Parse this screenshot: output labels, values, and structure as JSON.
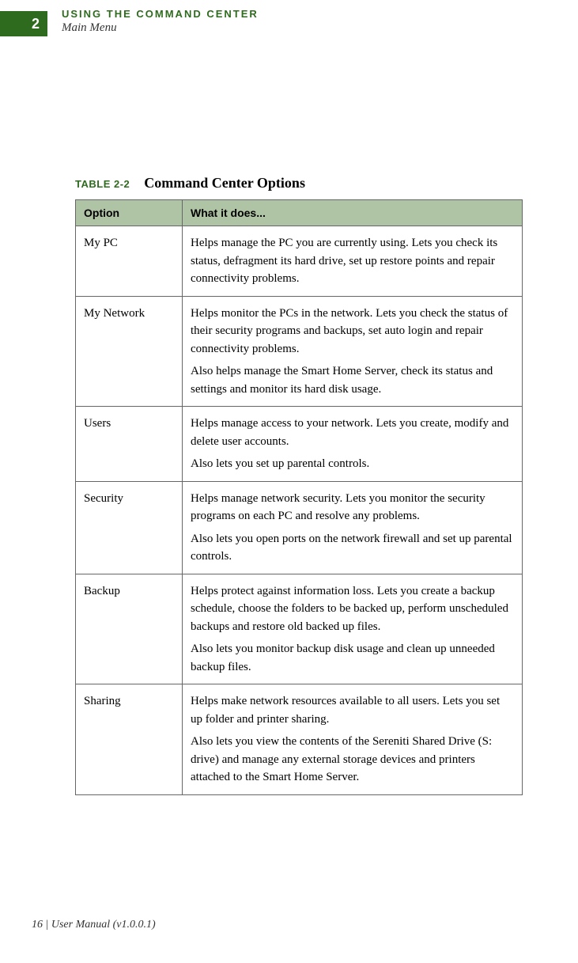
{
  "header": {
    "chapter_number": "2",
    "title": "USING THE COMMAND CENTER",
    "subtitle": "Main Menu"
  },
  "table": {
    "label": "TABLE 2-2",
    "title": "Command Center Options",
    "columns": {
      "option": "Option",
      "desc": "What it does..."
    },
    "rows": [
      {
        "option": "My PC",
        "p1": "Helps manage the PC you are currently using. Lets you check its status, defragment its hard drive, set up restore points and repair connectivity problems.",
        "p2": ""
      },
      {
        "option": "My Network",
        "p1": "Helps monitor the PCs in the network. Lets you check the status of their security programs and backups, set auto login and repair connectivity problems.",
        "p2": "Also helps manage the Smart Home Server, check its status and settings and monitor its hard disk usage."
      },
      {
        "option": "Users",
        "p1": "Helps manage access to your network. Lets you create, modify and delete user accounts.",
        "p2": "Also lets you set up parental controls."
      },
      {
        "option": "Security",
        "p1": "Helps manage network security. Lets you monitor the security programs on each PC and resolve any problems.",
        "p2": "Also lets you open ports on the network firewall and set up parental controls."
      },
      {
        "option": "Backup",
        "p1": "Helps protect against information loss. Lets you create a backup schedule, choose the folders to be backed up, perform unscheduled backups and restore old backed up files.",
        "p2": "Also lets you monitor backup disk usage and clean up unneeded backup files."
      },
      {
        "option": "Sharing",
        "p1": "Helps make network resources available to all users. Lets you set up folder and printer sharing.",
        "p2": "Also lets you view the contents of the Sereniti Shared Drive (S: drive) and manage any external storage devices and printers attached to the Smart Home Server."
      }
    ]
  },
  "footer": "16 | User Manual (v1.0.0.1)"
}
